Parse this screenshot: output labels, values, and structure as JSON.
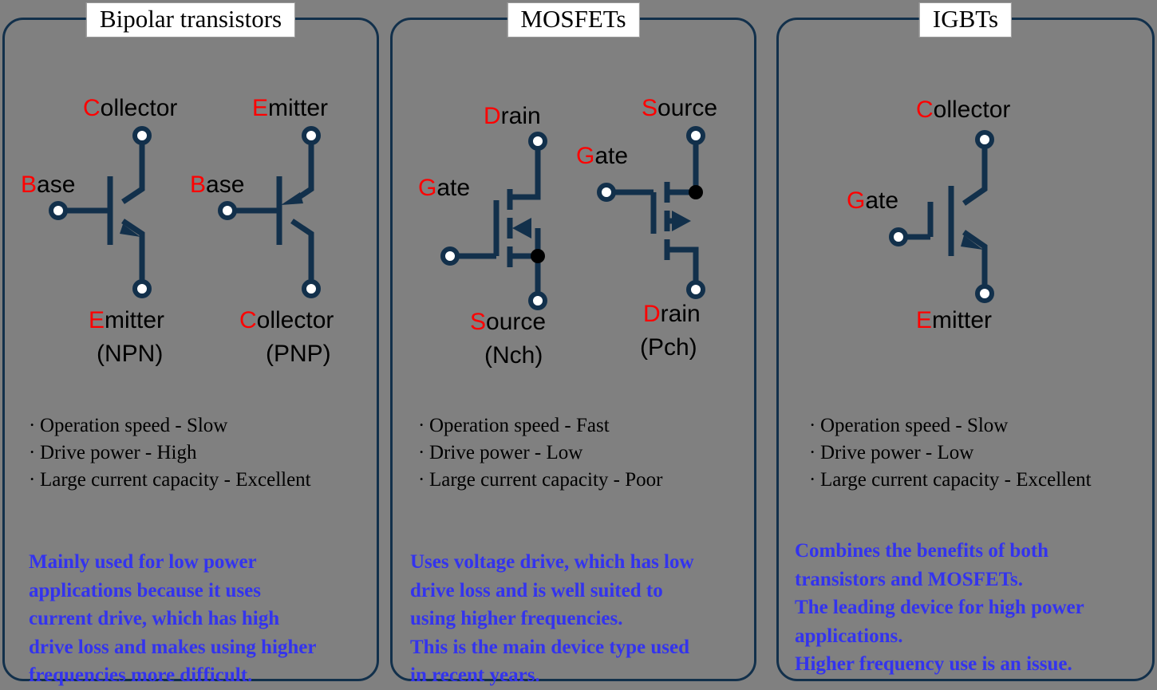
{
  "page": {
    "background_color": "#808080",
    "accent_color": "#12304b",
    "highlight_color": "#ff0000",
    "description_color": "#3333ee"
  },
  "panels": [
    {
      "title": "Bipolar transistors",
      "devices": [
        {
          "symbol": "npn-bjt-symbol",
          "type_label": "(NPN)",
          "terminals": [
            {
              "name": "collector",
              "initial": "C",
              "rest": "ollector",
              "position": "top"
            },
            {
              "name": "base",
              "initial": "B",
              "rest": "ase",
              "position": "left"
            },
            {
              "name": "emitter",
              "initial": "E",
              "rest": "mitter",
              "position": "bottom"
            }
          ]
        },
        {
          "symbol": "pnp-bjt-symbol",
          "type_label": "(PNP)",
          "terminals": [
            {
              "name": "emitter",
              "initial": "E",
              "rest": "mitter",
              "position": "top"
            },
            {
              "name": "base",
              "initial": "B",
              "rest": "ase",
              "position": "left"
            },
            {
              "name": "collector",
              "initial": "C",
              "rest": "ollector",
              "position": "bottom"
            }
          ]
        }
      ],
      "bullets": [
        "Operation  speed - Slow",
        "Drive power - High",
        "Large  current  capacity  - Excellent"
      ],
      "description": [
        "Mainly  used  for low power",
        "applications  because  it uses",
        "current  drive, which  has high",
        "drive  loss  and  makes  using  higher",
        "frequencies  more  difficult."
      ]
    },
    {
      "title": "MOSFETs",
      "devices": [
        {
          "symbol": "nch-mosfet-symbol",
          "type_label": "(Nch)",
          "terminals": [
            {
              "name": "drain",
              "initial": "D",
              "rest": "rain",
              "position": "top"
            },
            {
              "name": "gate",
              "initial": "G",
              "rest": "ate",
              "position": "left"
            },
            {
              "name": "source",
              "initial": "S",
              "rest": "ource",
              "position": "bottom"
            }
          ]
        },
        {
          "symbol": "pch-mosfet-symbol",
          "type_label": "(Pch)",
          "terminals": [
            {
              "name": "source",
              "initial": "S",
              "rest": "ource",
              "position": "top"
            },
            {
              "name": "gate",
              "initial": "G",
              "rest": "ate",
              "position": "left"
            },
            {
              "name": "drain",
              "initial": "D",
              "rest": "rain",
              "position": "bottom"
            }
          ]
        }
      ],
      "bullets": [
        "Operation  speed - Fast",
        "Drive power - Low",
        "Large  current  capacity  - Poor"
      ],
      "description": [
        "Uses voltage  drive, which  has low",
        "drive loss and  is well  suited to",
        "using  higher  frequencies.",
        "This is the main  device type used",
        "in recent  years."
      ]
    },
    {
      "title": "IGBTs",
      "devices": [
        {
          "symbol": "igbt-symbol",
          "type_label": "",
          "terminals": [
            {
              "name": "collector",
              "initial": "C",
              "rest": "ollector",
              "position": "top"
            },
            {
              "name": "gate",
              "initial": "G",
              "rest": "ate",
              "position": "left"
            },
            {
              "name": "emitter",
              "initial": "E",
              "rest": "mitter",
              "position": "bottom"
            }
          ]
        }
      ],
      "bullets": [
        "Operation  speed - Slow",
        "Drive power - Low",
        "Large  current  capacity  - Excellent"
      ],
      "description": [
        "Combines  the benefits  of both",
        "transistors  and  MOSFETs.",
        "The  leading  device for high power",
        "applications.",
        "Higher  frequency  use is an issue."
      ]
    }
  ]
}
